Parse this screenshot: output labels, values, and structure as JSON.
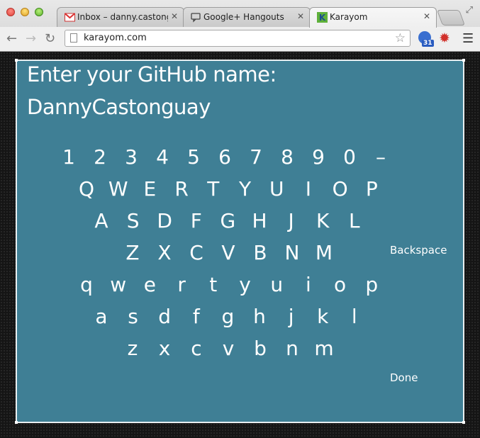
{
  "browser": {
    "tabs": [
      {
        "title": "Inbox – danny.castongu",
        "icon": "gmail-icon"
      },
      {
        "title": "Google+ Hangouts",
        "icon": "hangouts-icon"
      },
      {
        "title": "Karayom",
        "icon": "karayom-icon"
      }
    ],
    "url": "karayom.com",
    "calendar_badge": "31"
  },
  "page": {
    "prompt": "Enter your GitHub name:",
    "entered_text": "DannyCastonguay",
    "keyboard_rows": [
      [
        "1",
        "2",
        "3",
        "4",
        "5",
        "6",
        "7",
        "8",
        "9",
        "0",
        "–"
      ],
      [
        "Q",
        "W",
        "E",
        "R",
        "T",
        "Y",
        "U",
        "I",
        "O",
        "P"
      ],
      [
        "A",
        "S",
        "D",
        "F",
        "G",
        "H",
        "J",
        "K",
        "L"
      ],
      [
        "Z",
        "X",
        "C",
        "V",
        "B",
        "N",
        "M"
      ],
      [
        "q",
        "w",
        "e",
        "r",
        "t",
        "y",
        "u",
        "i",
        "o",
        "p"
      ],
      [
        "a",
        "s",
        "d",
        "f",
        "g",
        "h",
        "j",
        "k",
        "l"
      ],
      [
        "z",
        "x",
        "c",
        "v",
        "b",
        "n",
        "m"
      ]
    ],
    "backspace_label": "Backspace",
    "done_label": "Done"
  },
  "colors": {
    "panel": "#3f7f95",
    "text": "#ffffff"
  }
}
